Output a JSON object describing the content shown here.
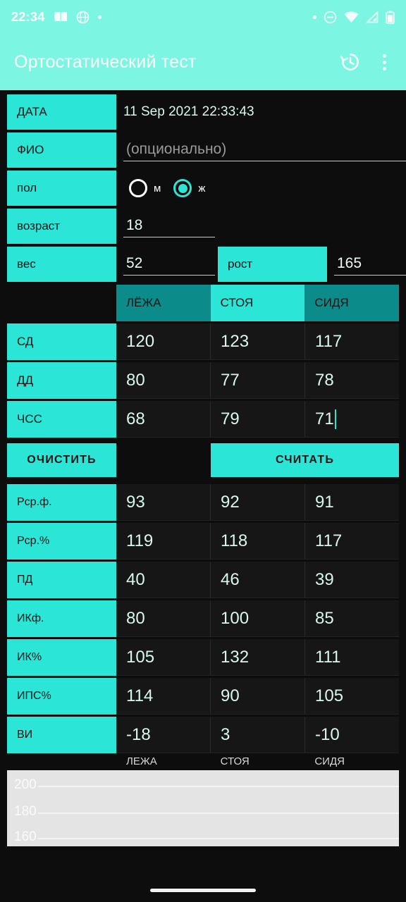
{
  "status_bar": {
    "time": "22:34",
    "left_icons": [
      "book-icon",
      "browser-globe-icon",
      "dot-icon"
    ],
    "right_icons": [
      "dot-icon",
      "do-not-disturb-icon",
      "wifi-icon",
      "cellular-signal-icon",
      "battery-icon"
    ]
  },
  "app_bar": {
    "title": "Ортостатический тест",
    "history_icon": "history-icon",
    "overflow_icon": "overflow-menu-icon"
  },
  "form": {
    "date": {
      "label": "ДАТА",
      "value": "11 Sep 2021 22:33:43"
    },
    "name": {
      "label": "ФИО",
      "value": "",
      "placeholder": "(опционально)"
    },
    "gender": {
      "label": "пол",
      "options": [
        {
          "label": "м",
          "selected": false
        },
        {
          "label": "ж",
          "selected": true
        }
      ]
    },
    "age": {
      "label": "возраст",
      "value": "18"
    },
    "weight": {
      "label": "вес",
      "value": "52"
    },
    "height": {
      "label": "рост",
      "value": "165"
    }
  },
  "measurements": {
    "columns": [
      "ЛЁЖА",
      "СТОЯ",
      "СИДЯ"
    ],
    "active_column": "СТОЯ",
    "rows": [
      {
        "label": "СД",
        "values": [
          "120",
          "123",
          "117"
        ]
      },
      {
        "label": "ДД",
        "values": [
          "80",
          "77",
          "78"
        ]
      },
      {
        "label": "ЧСС",
        "values": [
          "68",
          "79",
          "71"
        ]
      }
    ],
    "focused_cell": {
      "row": "ЧСС",
      "column": "СИДЯ"
    }
  },
  "buttons": {
    "clear": "ОЧИСТИТЬ",
    "calculate": "СЧИТАТЬ"
  },
  "results": {
    "rows": [
      {
        "label": "Рср.ф.",
        "values": [
          "93",
          "92",
          "91"
        ]
      },
      {
        "label": "Рср.%",
        "values": [
          "119",
          "118",
          "117"
        ]
      },
      {
        "label": "ПД",
        "values": [
          "40",
          "46",
          "39"
        ]
      },
      {
        "label": "ИКф.",
        "values": [
          "80",
          "100",
          "85"
        ]
      },
      {
        "label": "ИК%",
        "values": [
          "105",
          "132",
          "111"
        ]
      },
      {
        "label": "ИПС%",
        "values": [
          "114",
          "90",
          "105"
        ]
      },
      {
        "label": "ВИ",
        "values": [
          "-18",
          "3",
          "-10"
        ]
      }
    ]
  },
  "axis_labels": [
    "ЛЕЖА",
    "СТОЯ",
    "СИДЯ"
  ],
  "chart_data": {
    "type": "line",
    "title": "",
    "xlabel": "",
    "ylabel": "",
    "categories": [
      "ЛЕЖА",
      "СТОЯ",
      "СИДЯ"
    ],
    "yticks": [
      "200",
      "180",
      "160"
    ],
    "ylim": [
      150,
      210
    ],
    "grid": true,
    "legend": "none",
    "series": [],
    "background": "#E4E4E4"
  },
  "colors": {
    "accent": "#2BE6D6",
    "accent_header": "#0C8B8B",
    "app_bar": "#7DF5E3",
    "background": "#0d0d0d",
    "cell_background": "#161616",
    "value_text": "#d9f7ee"
  },
  "nav": {
    "home_indicator": "home-indicator"
  }
}
